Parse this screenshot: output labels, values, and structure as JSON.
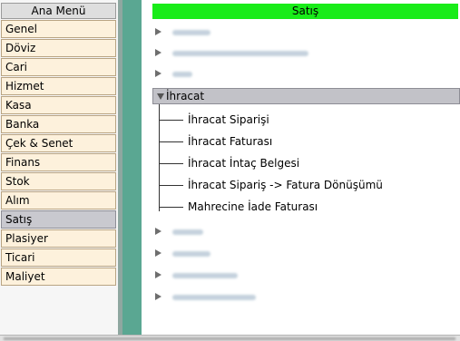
{
  "menu": {
    "header": "Ana Menü",
    "items": [
      {
        "label": "Genel",
        "active": false
      },
      {
        "label": "Döviz",
        "active": false
      },
      {
        "label": "Cari",
        "active": false
      },
      {
        "label": "Hizmet",
        "active": false
      },
      {
        "label": "Kasa",
        "active": false
      },
      {
        "label": "Banka",
        "active": false
      },
      {
        "label": "Çek & Senet",
        "active": false
      },
      {
        "label": "Finans",
        "active": false
      },
      {
        "label": "Stok",
        "active": false
      },
      {
        "label": "Alım",
        "active": false
      },
      {
        "label": "Satış",
        "active": true
      },
      {
        "label": "Plasiyer",
        "active": false
      },
      {
        "label": "Ticari",
        "active": false
      },
      {
        "label": "Maliyet",
        "active": false
      }
    ]
  },
  "panel": {
    "title": "Satış",
    "collapsed_top_count": 3,
    "expanded_group": {
      "label": "İhracat",
      "children": [
        "İhracat Siparişi",
        "İhracat Faturası",
        "İhracat İntaç Belgesi",
        "İhracat Sipariş -> Fatura Dönüşümü",
        "Mahrecine İade Faturası"
      ]
    },
    "collapsed_bottom_count": 4
  },
  "colors": {
    "title_bar": "#19ec19",
    "menu_item_bg": "#fdf1dc",
    "menu_active_bg": "#c9c9cf",
    "strip": "#5aa792",
    "expanded_bg": "#c2c2c8"
  }
}
